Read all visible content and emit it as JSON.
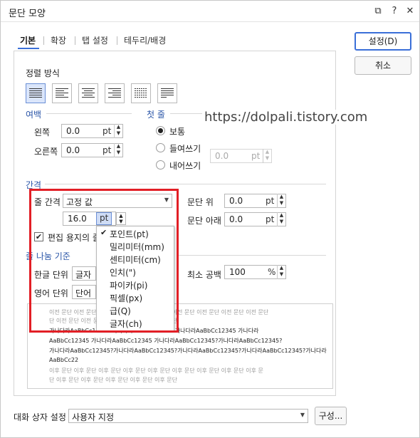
{
  "window": {
    "title": "문단 모양",
    "help_label": "?",
    "close_label": "✕",
    "pin_label": "⧉"
  },
  "tabs": [
    {
      "label": "기본"
    },
    {
      "label": "확장"
    },
    {
      "label": "탭 설정"
    },
    {
      "label": "테두리/배경"
    }
  ],
  "buttons": {
    "ok_label": "설정(D)",
    "cancel_label": "취소"
  },
  "alignment": {
    "section_label": "정렬 방식",
    "selected": "justify"
  },
  "margin": {
    "section_label": "여백",
    "left_label": "왼쪽",
    "left_value": "0.0",
    "left_unit": "pt",
    "right_label": "오른쪽",
    "right_value": "0.0",
    "right_unit": "pt"
  },
  "first_line": {
    "section_label": "첫 줄",
    "options": [
      "보통",
      "들여쓰기",
      "내어쓰기"
    ],
    "selected": "보통",
    "value": "0.0",
    "unit": "pt"
  },
  "watermark": "https://dolpali.tistory.com",
  "spacing": {
    "section_label": "간격",
    "line_spacing_label": "줄 간격",
    "line_spacing_type": "고정 값",
    "line_spacing_value": "16.0",
    "line_spacing_unit": "pt",
    "above_label": "문단 위",
    "above_value": "0.0",
    "above_unit": "pt",
    "below_label": "문단 아래",
    "below_value": "0.0",
    "below_unit": "pt",
    "grid_label": "편집 용지의 줄"
  },
  "unit_menu": {
    "items": [
      "포인트(pt)",
      "밀리미터(mm)",
      "센티미터(cm)",
      "인치(\")",
      "파이카(pi)",
      "픽셀(px)",
      "급(Q)",
      "글자(ch)"
    ],
    "selected": "포인트(pt)"
  },
  "line_break": {
    "section_label": "줄 나눔 기준",
    "korean_label": "한글 단위",
    "korean_value": "글자",
    "english_label": "영어 단위",
    "english_value": "단어",
    "min_space_label": "최소 공백",
    "min_space_value": "100",
    "min_space_unit": "%"
  },
  "preview": {
    "lines": [
      "이전 문단 이전 문단 이전 문단 이전 문단 이전 문단 이전 문단 이전 문단 이전 문단 이전 문단",
      "단 이전 문단 이전 문단 이전 문단 이전 문단 이전 문단",
      "가나다라AaBbCc12345   가나다라AaBbCc12345   가나다라AaBbCc12345   가나다라",
      "AaBbCc12345  가나다라AaBbCc12345  가나다라AaBbCc12345?가나다라AaBbCc12345?",
      "가나다라AaBbCc12345?가나다라AaBbCc12345?가나다라AaBbCc12345?가나다라AaBbCc12345?가나다라",
      "AaBbCc22",
      "이후 문단 이후 문단 이후 문단 이후 문단 이후 문단 이후 문단 이후 문단 이후 문단 이후 문",
      "단 이후 문단 이후 문단 이후 문단 이후 문단 이후 문단"
    ]
  },
  "footer": {
    "dialog_setting_label": "대화 상자 설정",
    "dialog_setting_value": "사용자 지정",
    "config_button_label": "구성..."
  }
}
